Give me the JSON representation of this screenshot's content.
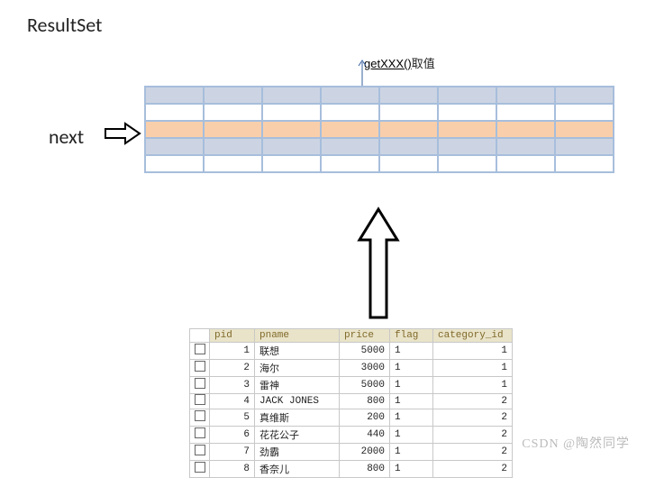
{
  "title": "ResultSet",
  "getxxx": {
    "fn": "getXXX()",
    "suffix": "取值"
  },
  "next_label": "next",
  "watermark": "CSDN @陶然同学",
  "db": {
    "headers": {
      "pid": "pid",
      "pname": "pname",
      "price": "price",
      "flag": "flag",
      "category_id": "category_id"
    },
    "rows": [
      {
        "pid": "1",
        "pname": "联想",
        "price": "5000",
        "flag": "1",
        "cat": "1"
      },
      {
        "pid": "2",
        "pname": "海尔",
        "price": "3000",
        "flag": "1",
        "cat": "1"
      },
      {
        "pid": "3",
        "pname": "雷神",
        "price": "5000",
        "flag": "1",
        "cat": "1"
      },
      {
        "pid": "4",
        "pname": "JACK JONES",
        "price": "800",
        "flag": "1",
        "cat": "2"
      },
      {
        "pid": "5",
        "pname": "真维斯",
        "price": "200",
        "flag": "1",
        "cat": "2"
      },
      {
        "pid": "6",
        "pname": "花花公子",
        "price": "440",
        "flag": "1",
        "cat": "2"
      },
      {
        "pid": "7",
        "pname": "劲霸",
        "price": "2000",
        "flag": "1",
        "cat": "2"
      },
      {
        "pid": "8",
        "pname": "香奈儿",
        "price": "800",
        "flag": "1",
        "cat": "2"
      }
    ]
  },
  "chart_data": {
    "type": "table",
    "title": "ResultSet rows",
    "columns": [
      "pid",
      "pname",
      "price",
      "flag",
      "category_id"
    ],
    "rows": [
      [
        1,
        "联想",
        5000,
        1,
        1
      ],
      [
        2,
        "海尔",
        3000,
        1,
        1
      ],
      [
        3,
        "雷神",
        5000,
        1,
        1
      ],
      [
        4,
        "JACK JONES",
        800,
        1,
        2
      ],
      [
        5,
        "真维斯",
        200,
        1,
        2
      ],
      [
        6,
        "花花公子",
        440,
        1,
        2
      ],
      [
        7,
        "劲霸",
        2000,
        1,
        2
      ],
      [
        8,
        "香奈儿",
        800,
        1,
        2
      ]
    ]
  }
}
